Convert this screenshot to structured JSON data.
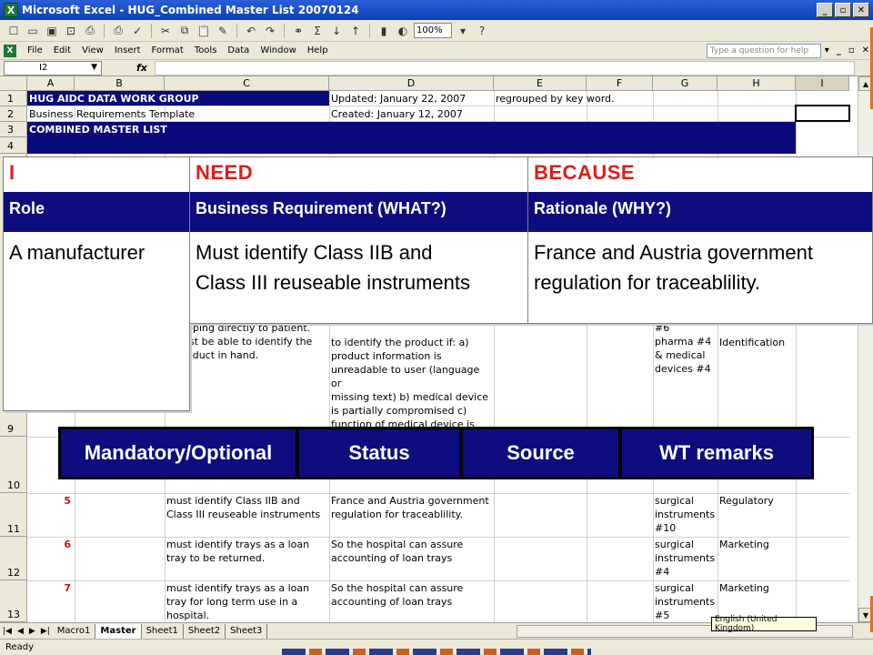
{
  "window": {
    "title": "Microsoft Excel - HUG_Combined Master List 20070124",
    "buttons": [
      "_",
      "▫",
      "✕"
    ]
  },
  "toolbar": {
    "zoom": "100%"
  },
  "menu": {
    "items": [
      "File",
      "Edit",
      "View",
      "Insert",
      "Format",
      "Tools",
      "Data",
      "Window",
      "Help"
    ],
    "ask_placeholder": "Type a question for help"
  },
  "formula_bar": {
    "name_box": "I2",
    "fx": "fx"
  },
  "columns": [
    "A",
    "B",
    "C",
    "D",
    "E",
    "F",
    "G",
    "H",
    "I"
  ],
  "rows": {
    "r1": {
      "num": "1",
      "a": "HUG AIDC DATA WORK GROUP",
      "d": "Updated: January 22, 2007",
      "e": "regrouped by key word."
    },
    "r2": {
      "num": "2",
      "a": "Business Requirements Template",
      "d": "Created: January 12, 2007"
    },
    "r3": {
      "num": "3",
      "a": "COMBINED MASTER LIST"
    },
    "r4": {
      "num": "4"
    },
    "r9": {
      "num": "9",
      "c": "pping directly to patient.\nist be able to identify the\noduct in hand.",
      "d": "to identify the product if: a)\nproduct information is\nunreadable to user (language or\nmissing text) b) medical device\nis partially compromised  c)\nfunction of medical device is",
      "g": "#6\npharma #4\n& medical\ndevices #4",
      "h": "Identification"
    },
    "r10": {
      "num": "10"
    },
    "r11": {
      "num": "11",
      "a": "5",
      "c": "must identify Class IIB and\nClass III reuseable instruments",
      "d": "France and Austria government\nregulation for traceablility.",
      "g": "surgical\ninstruments\n#10",
      "h": "Regulatory"
    },
    "r12": {
      "num": "12",
      "a": "6",
      "c": "must identify trays as a loan\ntray to be returned.",
      "d": "So the hospital can assure\naccounting of loan trays",
      "g": "surgical\ninstruments\n#4",
      "h": "Marketing"
    },
    "r13": {
      "num": "13",
      "a": "7",
      "c": "must identify trays as a loan\ntray for long term use in a\nhospital.",
      "d": "So the hospital can assure\naccounting of loan trays",
      "g": "surgical\ninstruments\n#5",
      "h": "Marketing"
    }
  },
  "overlay": {
    "col1": {
      "head": "I",
      "sub": "Role",
      "body": "A manufacturer"
    },
    "col2": {
      "head": "NEED",
      "sub": "Business Requirement (WHAT?)",
      "body": "Must identify Class IIB and\nClass III reuseable instruments"
    },
    "col3": {
      "head": "BECAUSE",
      "sub": "Rationale (WHY?)",
      "body": "France and Austria government\nregulation for traceablility."
    }
  },
  "overlay2": [
    "Mandatory/Optional",
    "Status",
    "Source",
    "WT remarks"
  ],
  "sheets": [
    "Macro1",
    "Master",
    "Sheet1",
    "Sheet2",
    "Sheet3"
  ],
  "active_sheet": "Master",
  "status": "Ready",
  "language_tip": "English (United Kingdom)"
}
